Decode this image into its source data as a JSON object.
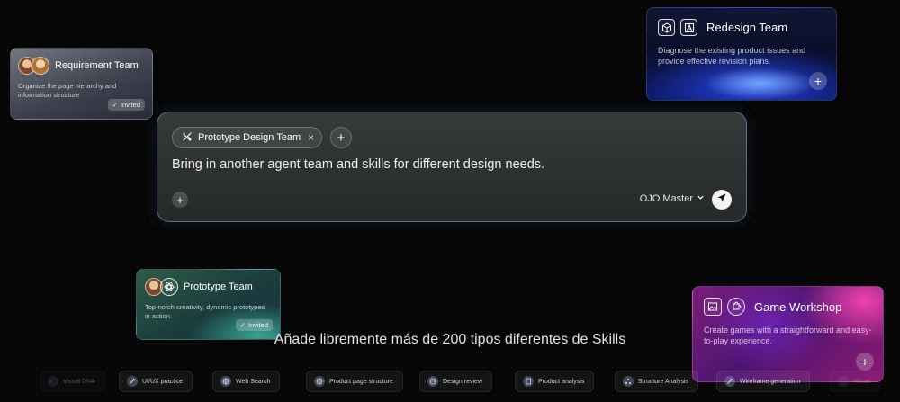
{
  "cards": {
    "requirement": {
      "title": "Requirement Team",
      "desc": "Organize the page hierarchy and information structure",
      "badge": "Invited"
    },
    "redesign": {
      "title": "Redesign Team",
      "desc": "Diagnose the existing product issues and provide effective revision plans.",
      "action": "+"
    },
    "prototype": {
      "title": "Prototype Team",
      "desc": "Top-notch creativity, dynamic prototypes in action.",
      "badge": "Invited"
    },
    "game": {
      "title": "Game Workshop",
      "desc": "Create games with a straightforward and easy-to-play experience.",
      "action": "+"
    }
  },
  "composer": {
    "chip_label": "Prototype Design Team",
    "chip_close": "×",
    "add_label": "+",
    "message": "Bring in another agent team and skills for different design needs.",
    "attach_label": "+",
    "model": "OJO Master"
  },
  "tagline": "Añade libremente más de 200 tipos diferentes de Skills",
  "skills": [
    "Visual DNA",
    "UI/UX practice",
    "Web Search",
    "Product page structure",
    "Design review",
    "Product analysis",
    "Structure Analysis",
    "Wireframe generation",
    "Visual"
  ],
  "colors": {
    "redesign_accent": "#1e3cd8",
    "game_accent": "#d0289a",
    "prototype_accent": "#3fae8c",
    "composer_border": "#96b4e6"
  }
}
